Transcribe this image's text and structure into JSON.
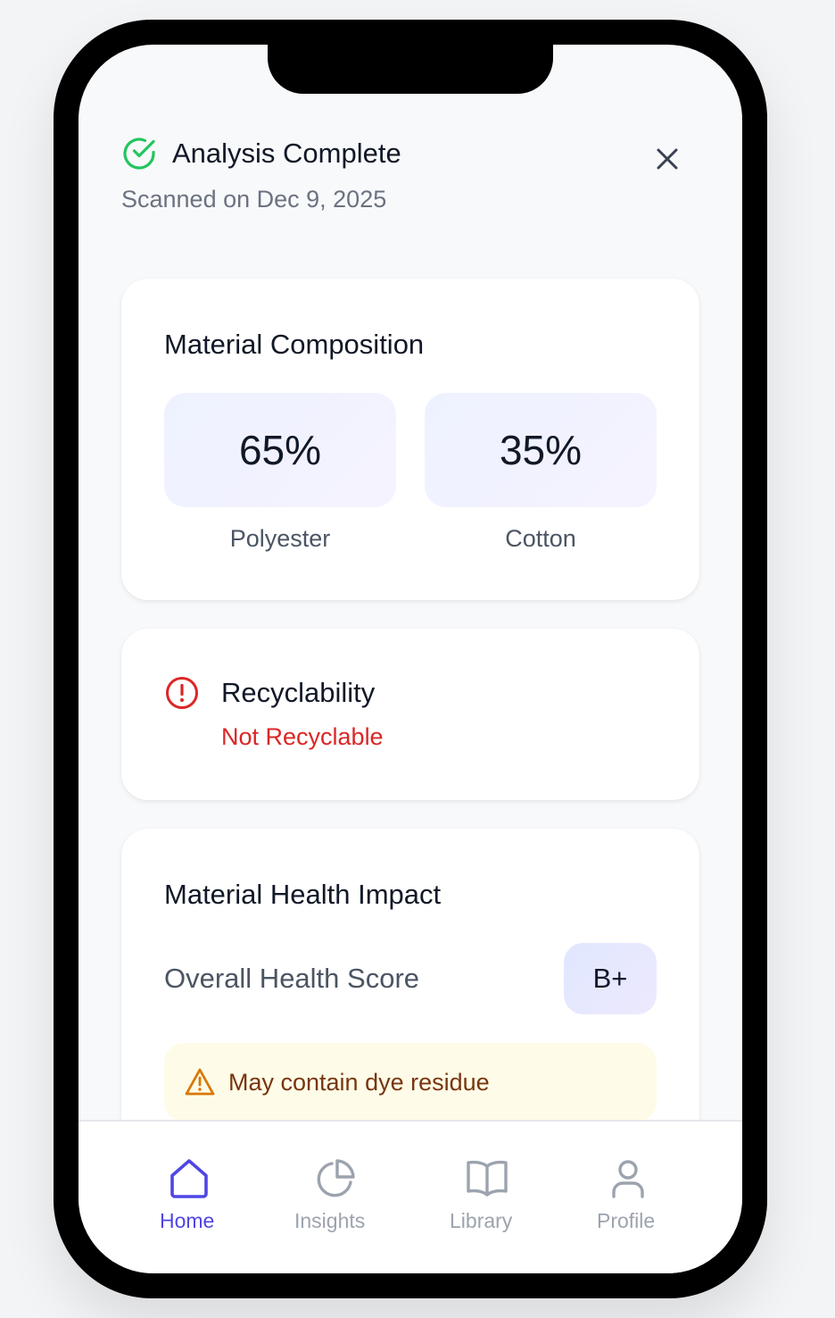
{
  "header": {
    "title": "Analysis Complete",
    "subtitle": "Scanned on Dec 9, 2025",
    "check_icon": "check-circle-icon",
    "close_icon": "close-icon"
  },
  "composition": {
    "title": "Material Composition",
    "items": [
      {
        "percent": "65%",
        "label": "Polyester"
      },
      {
        "percent": "35%",
        "label": "Cotton"
      }
    ]
  },
  "recyclability": {
    "title": "Recyclability",
    "status": "Not Recyclable",
    "icon": "alert-circle-icon",
    "status_color": "#dc2626"
  },
  "health": {
    "title": "Material Health Impact",
    "score_label": "Overall Health Score",
    "grade": "B+",
    "warning": "May contain dye residue",
    "warning_icon": "warning-triangle-icon"
  },
  "nav": {
    "items": [
      {
        "label": "Home",
        "icon": "home-icon",
        "active": true
      },
      {
        "label": "Insights",
        "icon": "pie-chart-icon",
        "active": false
      },
      {
        "label": "Library",
        "icon": "book-icon",
        "active": false
      },
      {
        "label": "Profile",
        "icon": "user-icon",
        "active": false
      }
    ],
    "active_color": "#4f46e5",
    "inactive_color": "#9ca3af"
  }
}
